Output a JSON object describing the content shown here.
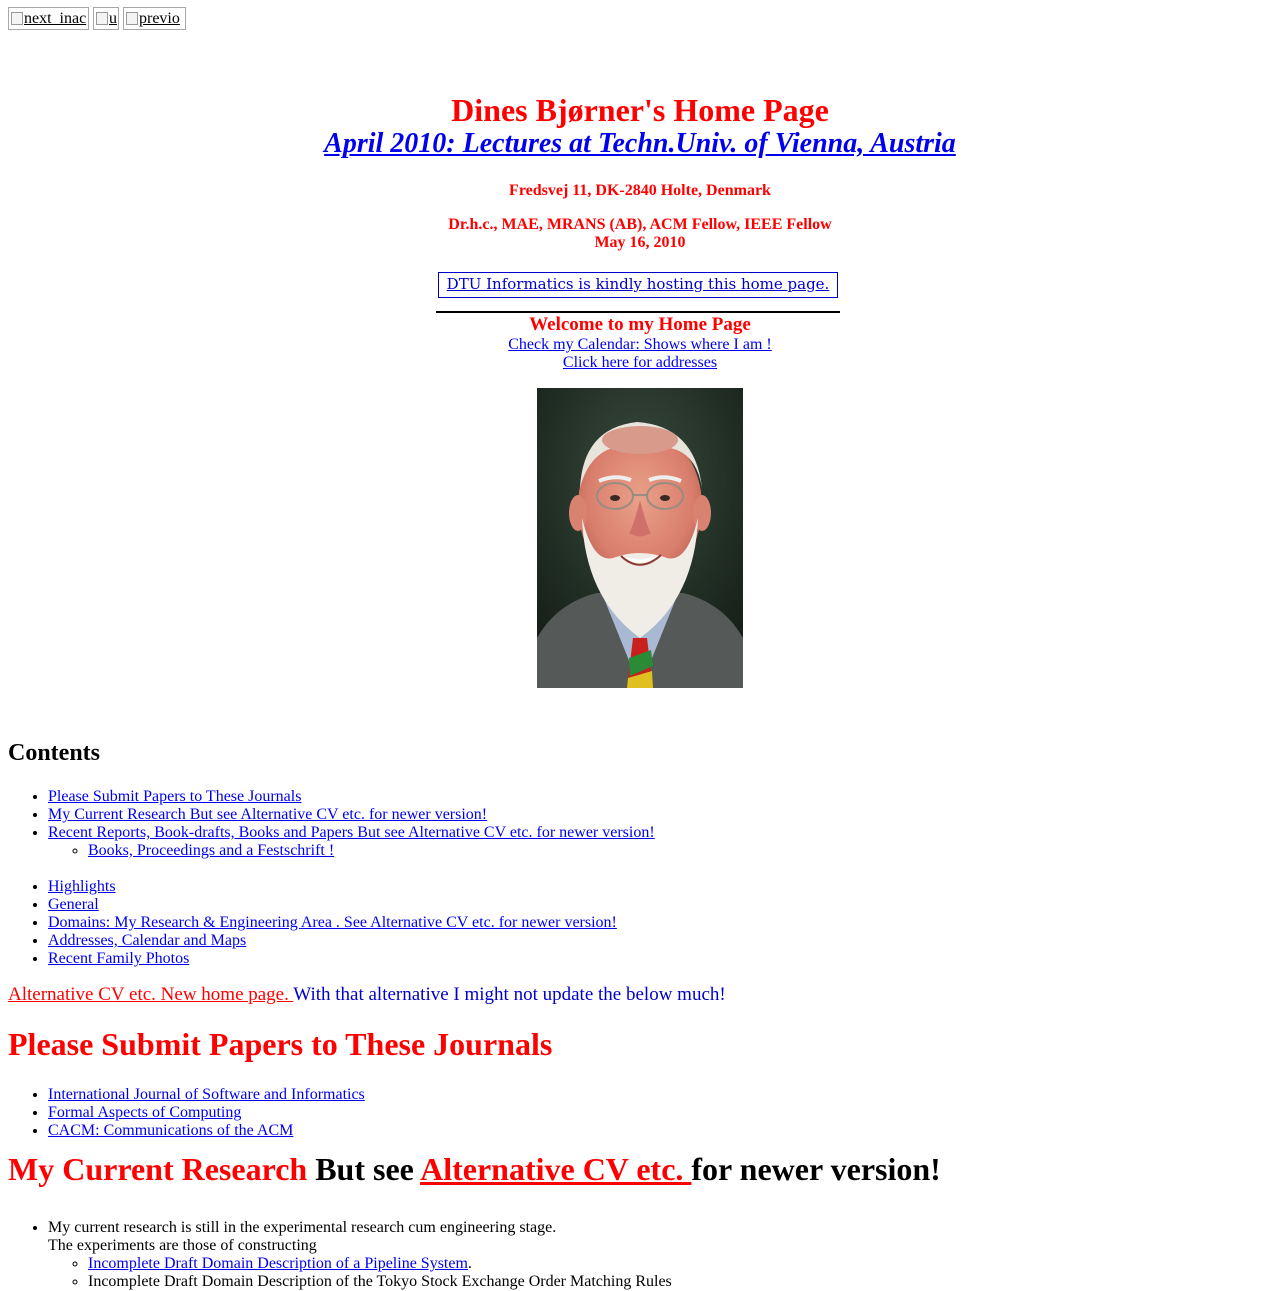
{
  "nav": {
    "next_alt": "next_inac",
    "up_alt": "u",
    "prev_alt": "previo"
  },
  "header": {
    "title": "Dines Bjørner's Home Page",
    "subtitle_link": "April 2010: Lectures at Techn.Univ. of Vienna, Austria",
    "address": "Fredsvej 11, DK-2840 Holte, Denmark",
    "qualifications": "Dr.h.c., MAE, MRANS (AB), ACM Fellow, IEEE Fellow",
    "date": "May 16, 2010",
    "hosting_note": "DTU Informatics is kindly hosting this home page."
  },
  "welcome": {
    "heading": "Welcome to my Home Page",
    "calendar_link": "Check my Calendar: Shows where I am !",
    "addresses_link": "Click here for addresses"
  },
  "contents": {
    "heading": "Contents",
    "items": [
      "Please Submit Papers to These Journals",
      "My Current Research But see Alternative CV etc. for newer version!",
      "Recent Reports, Book-drafts, Books and Papers But see Alternative CV etc. for newer version!"
    ],
    "sub_items": [
      "Books, Proceedings and a Festschrift !"
    ],
    "items_after": [
      "Highlights",
      "General",
      "Domains: My Research & Engineering Area . See Alternative CV etc. for newer version!",
      "Addresses, Calendar and Maps",
      "Recent Family Photos"
    ]
  },
  "alternative": {
    "link": "Alternative CV etc. New home page. ",
    "tail": "With that alternative I might not update the below much!"
  },
  "journals": {
    "heading": "Please Submit Papers to These Journals",
    "items": [
      "International Journal of Software and Informatics",
      "Formal Aspects of Computing",
      "CACM: Communications of the ACM"
    ]
  },
  "research": {
    "heading_red": "My Current Research",
    "heading_mid": " But see ",
    "heading_link": "Alternative CV etc. ",
    "heading_tail": "for newer version!",
    "line1": "My current research is still in the experimental research cum engineering stage.",
    "line2": "The experiments are those of constructing",
    "sub_items": [
      "Incomplete Draft Domain Description of a Pipeline System",
      "Incomplete Draft Domain Description of the Tokyo Stock Exchange Order Matching Rules"
    ],
    "period": "."
  }
}
